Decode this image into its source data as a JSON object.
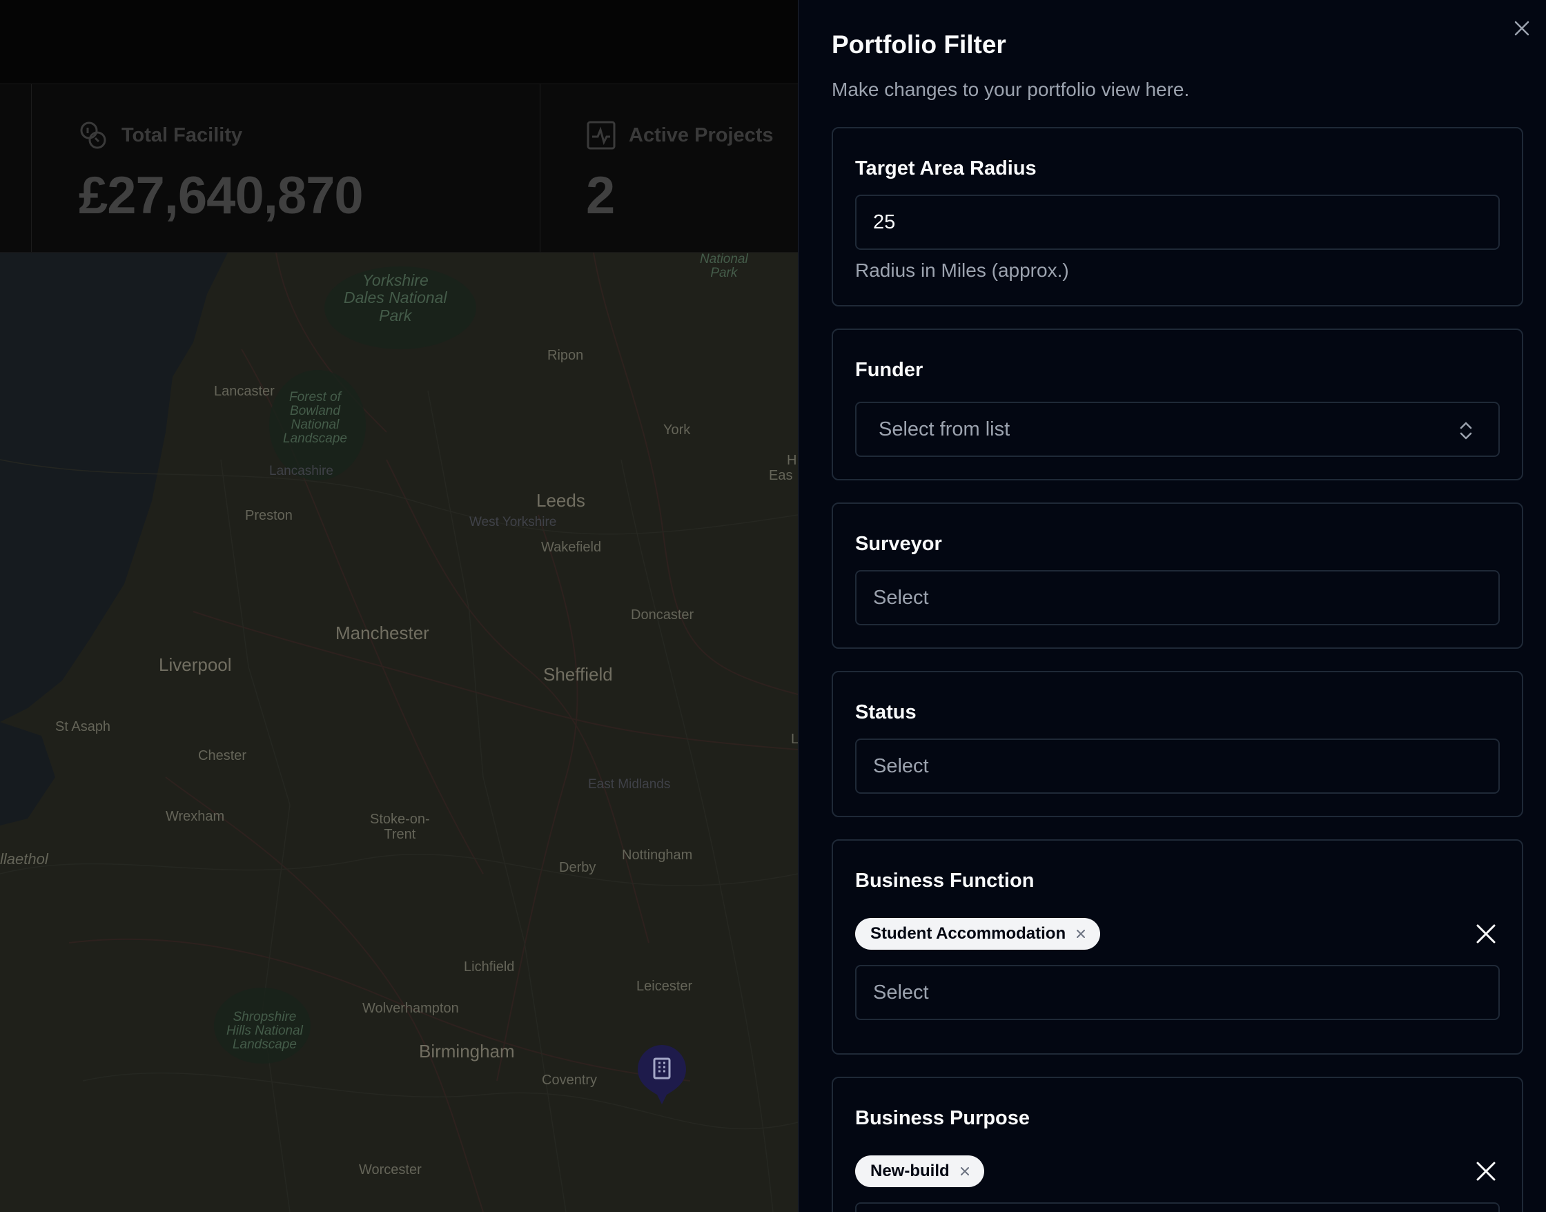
{
  "stats": {
    "total_facility": {
      "label": "Total Facility",
      "value": "£27,640,870",
      "icon": "coins-icon"
    },
    "active_projects": {
      "label": "Active Projects",
      "value": "2",
      "icon": "activity-icon"
    }
  },
  "map": {
    "labels": {
      "yorkshire_dales": "Yorkshire\nDales National\nPark",
      "national_park": "National\nPark",
      "ripon": "Ripon",
      "lancaster": "Lancaster",
      "bowland": "Forest of\nBowland\nNational\nLandscape",
      "lancashire": "Lancashire",
      "york": "York",
      "leeds": "Leeds",
      "west_yorkshire": "West Yorkshire",
      "wakefield": "Wakefield",
      "preston": "Preston",
      "doncaster": "Doncaster",
      "manchester": "Manchester",
      "liverpool": "Liverpool",
      "sheffield": "Sheffield",
      "st_asaph": "St Asaph",
      "chester": "Chester",
      "east_midlands": "East Midlands",
      "wrexham": "Wrexham",
      "stoke": "Stoke-on-\nTrent",
      "nottingham": "Nottingham",
      "derby": "Derby",
      "llaethol": "llaethol",
      "lichfield": "Lichfield",
      "leicester": "Leicester",
      "shropshire": "Shropshire\nHills National\nLandscape",
      "wolverhampton": "Wolverhampton",
      "birmingham": "Birmingham",
      "coventry": "Coventry",
      "worcester": "Worcester",
      "edge_h": "H",
      "edge_eas": "Eas",
      "edge_l": "L"
    }
  },
  "drawer": {
    "title": "Portfolio Filter",
    "description": "Make changes to your portfolio view here.",
    "radius": {
      "label": "Target Area Radius",
      "value": "25",
      "hint": "Radius in Miles (approx.)"
    },
    "funder": {
      "label": "Funder",
      "placeholder": "Select from list"
    },
    "surveyor": {
      "label": "Surveyor",
      "placeholder": "Select"
    },
    "status": {
      "label": "Status",
      "placeholder": "Select"
    },
    "business_function": {
      "label": "Business Function",
      "chips": [
        "Student Accommodation"
      ],
      "placeholder": "Select"
    },
    "business_purpose": {
      "label": "Business Purpose",
      "chips": [
        "New-build"
      ]
    }
  }
}
